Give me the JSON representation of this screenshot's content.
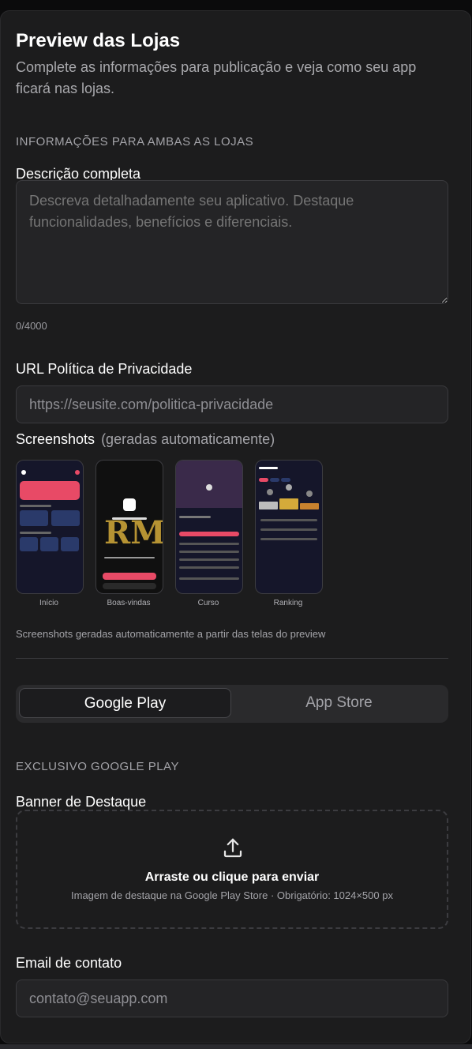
{
  "header": {
    "title": "Preview das Lojas",
    "subtitle": "Complete as informações para publicação e veja como seu app ficará nas lojas."
  },
  "common": {
    "section_label": "INFORMAÇÕES PARA AMBAS AS LOJAS",
    "description": {
      "label": "Descrição completa",
      "placeholder": "Descreva detalhadamente seu aplicativo. Destaque funcionalidades, benefícios e diferenciais.",
      "value": "",
      "counter": "0/4000"
    },
    "privacy_url": {
      "label": "URL Política de Privacidade",
      "placeholder": "https://seusite.com/politica-privacidade",
      "value": ""
    }
  },
  "screenshots": {
    "title": "Screenshots",
    "note": "(geradas automaticamente)",
    "items": [
      {
        "caption": "Início"
      },
      {
        "caption": "Boas-vindas"
      },
      {
        "caption": "Curso"
      },
      {
        "caption": "Ranking"
      }
    ],
    "footer_note": "Screenshots geradas automaticamente a partir das telas do preview"
  },
  "store_tabs": {
    "items": [
      {
        "label": "Google Play",
        "active": true
      },
      {
        "label": "App Store",
        "active": false
      }
    ]
  },
  "google_play": {
    "section_label": "EXCLUSIVO GOOGLE PLAY",
    "banner": {
      "label": "Banner de Destaque",
      "icon": "upload-icon",
      "main_text": "Arraste ou clique para enviar",
      "sub_text": "Imagem de destaque na Google Play Store · Obrigatório: 1024×500 px"
    },
    "email": {
      "label": "Email de contato",
      "placeholder": "contato@seuapp.com",
      "value": ""
    }
  },
  "colors": {
    "background": "#1c1c1d",
    "input_bg": "#242426",
    "accent_pink": "#e84a66",
    "gold": "#d4aa3a"
  }
}
